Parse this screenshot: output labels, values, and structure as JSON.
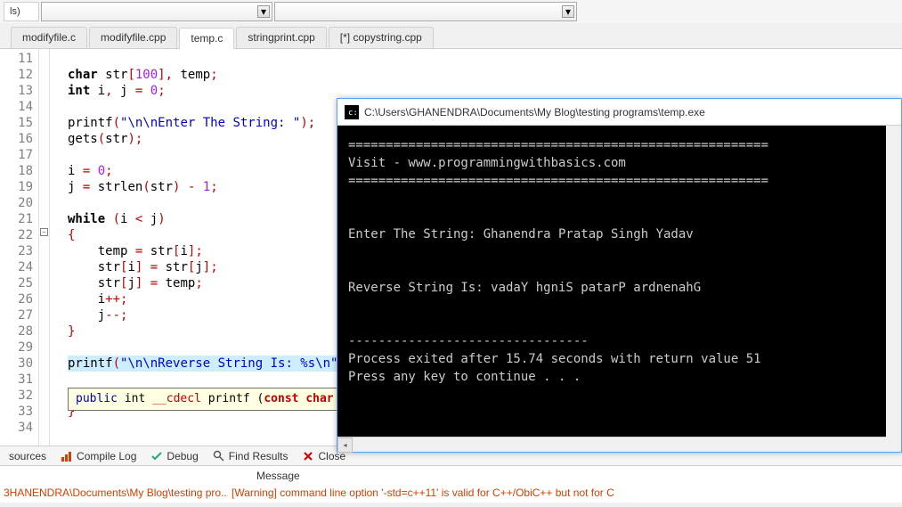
{
  "top": {
    "globals": "ls)"
  },
  "tabs": [
    {
      "label": "modifyfile.c"
    },
    {
      "label": "modifyfile.cpp"
    },
    {
      "label": "temp.c"
    },
    {
      "label": "stringprint.cpp"
    },
    {
      "label": "[*] copystring.cpp"
    }
  ],
  "active_tab": 2,
  "line_numbers": [
    "11",
    "12",
    "13",
    "14",
    "15",
    "16",
    "17",
    "18",
    "19",
    "20",
    "21",
    "22",
    "23",
    "24",
    "25",
    "26",
    "27",
    "28",
    "29",
    "30",
    "31",
    "32",
    "33",
    "34"
  ],
  "code": {
    "l11": "",
    "l12_kw": "char",
    "l12_rest1": " str",
    "l12_pu1": "[",
    "l12_nu": "100",
    "l12_pu2": "],",
    "l12_rest2": " temp",
    "l12_pu3": ";",
    "l13_kw": "int",
    "l13_rest1": " i",
    "l13_pu1": ",",
    "l13_rest2": " j ",
    "l13_pu2": "=",
    "l13_rest3": " ",
    "l13_nu": "0",
    "l13_pu3": ";",
    "l15_fn": "printf",
    "l15_pu1": "(",
    "l15_str": "\"\\n\\nEnter The String: \"",
    "l15_pu2": ");",
    "l16_fn": "gets",
    "l16_pu1": "(",
    "l16_a": "str",
    "l16_pu2": ");",
    "l18_a": "i ",
    "l18_pu1": "=",
    "l18_b": " ",
    "l18_nu": "0",
    "l18_pu2": ";",
    "l19_a": "j ",
    "l19_pu1": "=",
    "l19_b": " strlen",
    "l19_pu2": "(",
    "l19_c": "str",
    "l19_pu3": ")",
    "l19_d": " ",
    "l19_pu4": "-",
    "l19_e": " ",
    "l19_nu": "1",
    "l19_pu5": ";",
    "l21_kw": "while",
    "l21_s": " ",
    "l21_pu1": "(",
    "l21_a": "i ",
    "l21_pu2": "<",
    "l21_b": " j",
    "l21_pu3": ")",
    "l22_pu": "{",
    "l23_a": "temp ",
    "l23_pu1": "=",
    "l23_b": " str",
    "l23_pu2": "[",
    "l23_c": "i",
    "l23_pu3": "];",
    "l24_a": "str",
    "l24_pu1": "[",
    "l24_b": "i",
    "l24_pu2": "]",
    "l24_c": " ",
    "l24_pu3": "=",
    "l24_d": " str",
    "l24_pu4": "[",
    "l24_e": "j",
    "l24_pu5": "];",
    "l25_a": "str",
    "l25_pu1": "[",
    "l25_b": "j",
    "l25_pu2": "]",
    "l25_c": " ",
    "l25_pu3": "=",
    "l25_d": " temp",
    "l25_pu4": ";",
    "l26_a": "i",
    "l26_pu": "++;",
    "l27_a": "j",
    "l27_pu": "--;",
    "l28_pu": "}",
    "l30_fn": "printf",
    "l30_pu1": "(",
    "l30_str": "\"\\n\\nReverse String Is: %s\\n\"",
    "l32_pu": "}",
    "l33_pu": "}"
  },
  "tooltip": {
    "t1": "public",
    "t2": " int ",
    "t3": "__cdecl ",
    "t4": "printf ",
    "t5": "(",
    "t6": "const",
    "t7": " char ",
    "t8": "*"
  },
  "console": {
    "title": "C:\\Users\\GHANENDRA\\Documents\\My Blog\\testing programs\\temp.exe",
    "sep1": "========================================================",
    "line1": "Visit - www.programmingwithbasics.com",
    "sep2": "========================================================",
    "blank": "",
    "line2": "Enter The String: Ghanendra Pratap Singh Yadav",
    "line3": "Reverse String Is: vadaY hgniS patarP ardnenahG",
    "sep3": "--------------------------------",
    "line4": "Process exited after 15.74 seconds with return value 51",
    "line5": "Press any key to continue . . ."
  },
  "bottom_tabs": {
    "t1": "sources",
    "t2": "Compile Log",
    "t3": "Debug",
    "t4": "Find Results",
    "t5": "Close"
  },
  "message_header": "Message",
  "status": {
    "left": "3HANENDRA\\Documents\\My Blog\\testing pro...",
    "right": "[Warning] command line option '-std=c++11' is valid for C++/ObiC++ but not for C"
  }
}
